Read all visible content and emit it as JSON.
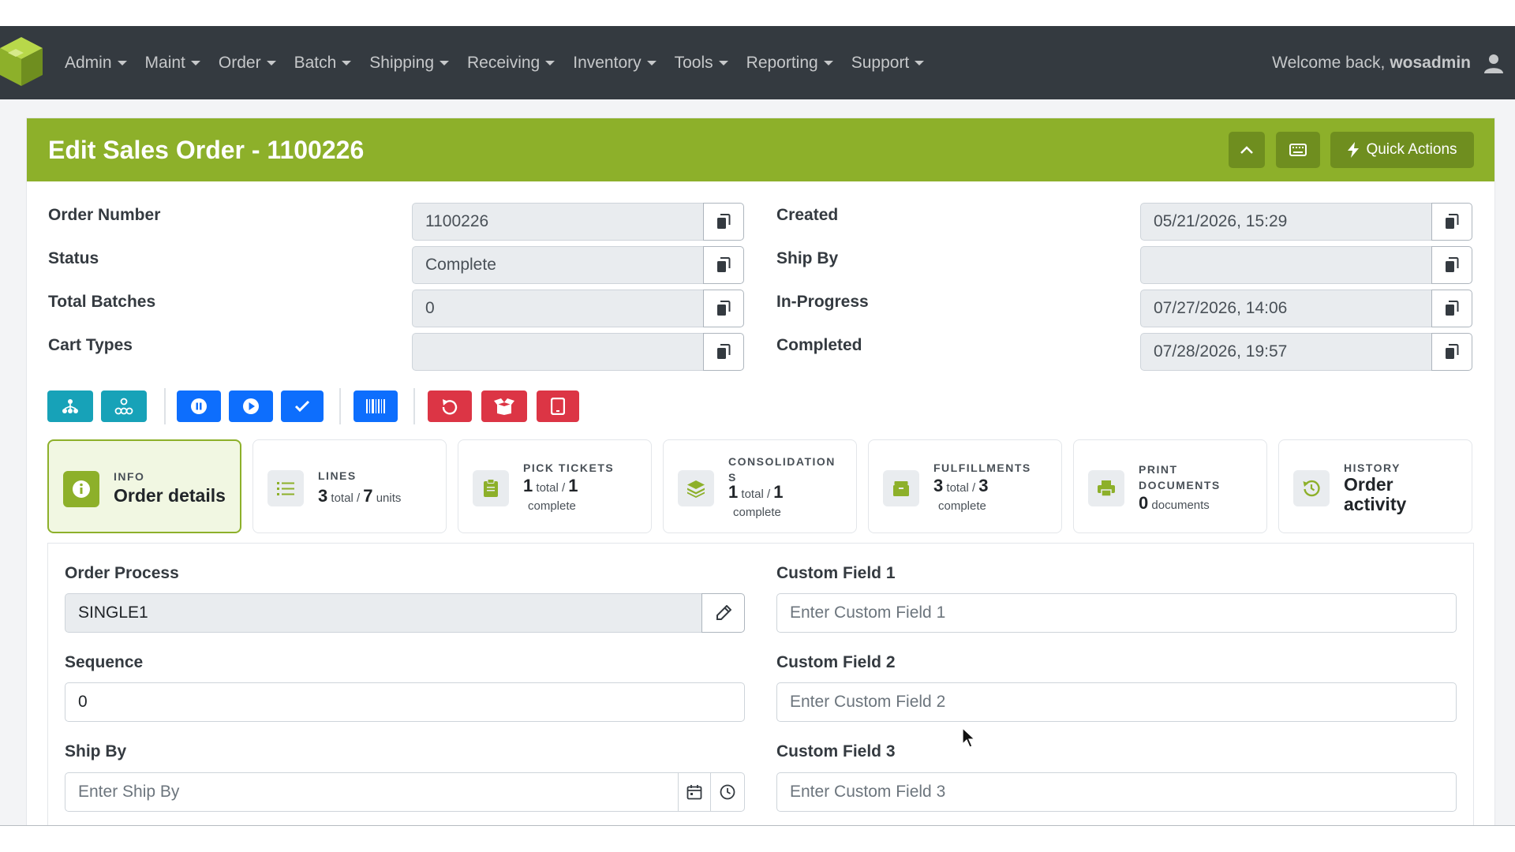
{
  "nav": {
    "menu": [
      "Admin",
      "Maint",
      "Order",
      "Batch",
      "Shipping",
      "Receiving",
      "Inventory",
      "Tools",
      "Reporting",
      "Support"
    ],
    "welcome_text": "Welcome back,",
    "username": "wosadmin"
  },
  "header": {
    "title": "Edit Sales Order - 1100226",
    "quick_actions_label": "Quick Actions"
  },
  "summary": {
    "left": [
      {
        "label": "Order Number",
        "value": "1100226"
      },
      {
        "label": "Status",
        "value": "Complete"
      },
      {
        "label": "Total Batches",
        "value": "0"
      },
      {
        "label": "Cart Types",
        "value": ""
      }
    ],
    "right": [
      {
        "label": "Created",
        "value": "05/21/2026, 15:29"
      },
      {
        "label": "Ship By",
        "value": ""
      },
      {
        "label": "In-Progress",
        "value": "07/27/2026, 14:06"
      },
      {
        "label": "Completed",
        "value": "07/28/2026, 19:57"
      }
    ]
  },
  "tabs": {
    "info": {
      "kicker": "INFO",
      "main": "Order details"
    },
    "lines": {
      "kicker": "LINES",
      "a": "3",
      "a_text": "total /",
      "b": "7",
      "b_text": "units"
    },
    "pick": {
      "kicker": "PICK TICKETS",
      "a": "1",
      "a_text": "total /",
      "b": "1",
      "sub": "complete"
    },
    "consolidation": {
      "kicker1": "CONSOLIDATION",
      "kicker2": "S",
      "a": "1",
      "a_text": "total /",
      "b": "1",
      "sub": "complete"
    },
    "fulfillments": {
      "kicker": "FULFILLMENTS",
      "a": "3",
      "a_text": "total /",
      "b": "3",
      "sub": "complete"
    },
    "print": {
      "kicker1": "PRINT",
      "kicker2": "DOCUMENTS",
      "a": "0",
      "a_text": "documents"
    },
    "history": {
      "kicker": "HISTORY",
      "main1": "Order",
      "main2": "activity"
    }
  },
  "form": {
    "order_process_label": "Order Process",
    "order_process_value": "SINGLE1",
    "sequence_label": "Sequence",
    "sequence_value": "0",
    "ship_by_label": "Ship By",
    "ship_by_placeholder": "Enter Ship By",
    "custom1_label": "Custom Field 1",
    "custom1_placeholder": "Enter Custom Field 1",
    "custom2_label": "Custom Field 2",
    "custom2_placeholder": "Enter Custom Field 2",
    "custom3_label": "Custom Field 3",
    "custom3_placeholder": "Enter Custom Field 3"
  },
  "colors": {
    "brand_green": "#8db02a",
    "navbar": "#343a40",
    "teal": "#17a2b8",
    "blue": "#0d6efd",
    "red": "#dc3545"
  }
}
